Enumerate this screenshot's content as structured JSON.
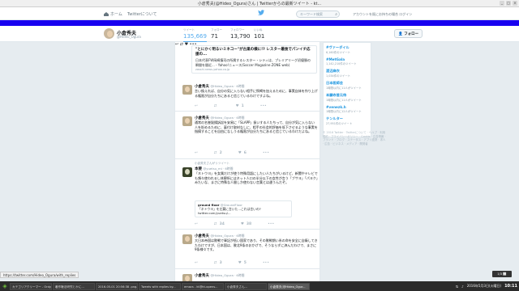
{
  "window": {
    "title": "小倉秀夫(@Hideo_Ogura)さん | Twitterからの最新ツイート - kt..."
  },
  "topnav": {
    "home_label": "ホーム",
    "about_label": "Twitterについて",
    "search_placeholder": "キーワード検索",
    "language_text": "アカウントを既にお持ちの場合 ログイン",
    "login_label": "ログイン"
  },
  "profile": {
    "name": "小倉秀夫",
    "handle": "@Hideo_Ogura",
    "stats": [
      {
        "label": "ツイート",
        "value": "135,669"
      },
      {
        "label": "フォロー",
        "value": "71"
      },
      {
        "label": "フォロワー",
        "value": "13,790"
      },
      {
        "label": "いいね",
        "value": "101"
      }
    ],
    "follow_label": "フォロー"
  },
  "card": {
    "title": "\"とにかく明るいミネコー\"が古巣の横に!? レスター最後でパンイチ応援の...",
    "desc": "日本代表FW岡崎慎司の所属するレスター・シティは、プレミアリーグ初優勝の瞬間を間近... - Yahoo!ニュース(Soccer Magazine ZONE web)",
    "url": "zasshi.news.yahoo.co.jp"
  },
  "tweets": [
    {
      "name": "小倉秀夫",
      "handle": "@Hideo_Ogura · 6時間",
      "text": "言い換えれば、自分の気に入らない相手に恫喝を加えるために、事実自体を作り上げる権限が自分たちにあると信じているわけですよね。",
      "retweets": "",
      "likes": "1"
    },
    {
      "name": "小倉秀夫",
      "handle": "@Hideo_Ogura · 6時間",
      "text": "通常の名誉毀損訴訟を安易に「SLAPP」扱いする人たちって、自分が気に入らない人を貶めるために、裏付け取材なしに、相手の社会的評価を低下させるような事実を指摘することを自由になしうる権限が自分たちにあると信じているわけだよね。",
      "retweets": "2",
      "likes": "6"
    },
    {
      "retweet_note": "小倉秀夫さんがリツイート",
      "name": "本要",
      "handle": "@yuetsu_mi · 6時間",
      "text": "「ネトウヨ」を女属だけが使う特殊用語にしたい人たちがいるけど、新聞やテレビでも頻々使われるし休憩所にはネット人口の半分以下の女性が言う「ブサヨ」「パヨク」みたいな、まさに特殊な人間しか使わない言葉とは違うんだぞ。",
      "quote_name": "ground floor",
      "quote_handle": "@GroundFloor",
      "quote_text": "「ネトウヨ」を左翼に言いた...これは言いの? twitter.com/yuetsu/...",
      "retweets": "34",
      "likes": "38"
    },
    {
      "name": "小倉秀夫",
      "handle": "@Hideo_Ogura · 6時間",
      "text": "大日本帝国は敗戦で軍記が低い国家であり、その敗戦期い系の命を安全に自衛してきたわけですが、日本国は、敗北9条のおかげで、そうならずに済んだわけで、まさに9条様々です。",
      "retweets": "3",
      "likes": "5"
    },
    {
      "name": "小倉秀夫",
      "handle": "@Hideo_Ogura · 6時間",
      "text": "",
      "retweets": "",
      "likes": ""
    }
  ],
  "trends": [
    {
      "name": "#ヴァーダイル",
      "count": "6,160件のツイート"
    },
    {
      "name": "#MetGala",
      "count": "1,142,210件のツイート"
    },
    {
      "name": "渡辺麻衣",
      "count": "1,034件のツイート"
    },
    {
      "name": "日本医師会",
      "count": "1時間以内に11人がツイート"
    },
    {
      "name": "本願寺首元待",
      "count": "1時間以内に11人がツイート"
    },
    {
      "name": "#venezk.h",
      "count": "1時間以内に12人がツイート"
    },
    {
      "name": "テンルター",
      "count": "27,951件のツイート"
    }
  ],
  "footer": "© 2016 Twitter · Twitterについて · ヘルプ · 利用規約 · プライバシーポリシー · Cookie · 広告情報 · ブランド · ブログ · ステータス · アプリ連携 · 求人 · 広告 · ビジネス · メディア · 開発者",
  "status": {
    "url": "https://twitter.com/Hideo_Ogura/with_replies",
    "mini": "1/3 ⬜"
  },
  "taskbar": {
    "tasks": [
      "カテゴリアクリーマー - Ordy...",
      "著作権法研究とかに...",
      "2016-05-01 20:56:38 .png...",
      "Tweets with replies by...",
      "emacs - kt@kt-opens...",
      "小倉秀夫さん...",
      "小倉秀夫(@Hideo_Ogur..."
    ],
    "clock": "10:11",
    "date": "2016年5月3日(火曜日)"
  }
}
